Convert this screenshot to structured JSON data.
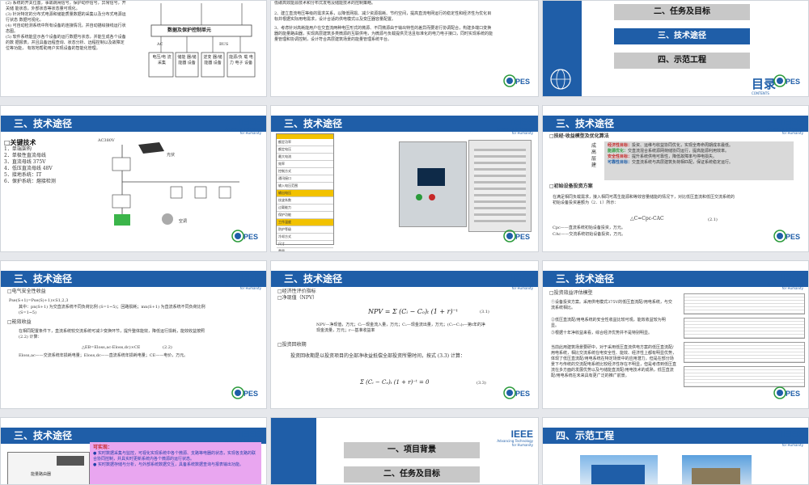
{
  "section_title": "三、技术途径",
  "ieee": {
    "word": "IEEE",
    "sub1": "Advancing Technology",
    "sub2": "for Humanity"
  },
  "pes": {
    "word": "PES",
    "sub": "Power & Energy Society"
  },
  "s1": {
    "items": [
      "(2) 系统的开关位置，事故跳闸信号，保护动作信号，异常信号，开关储 能状态，外部状态等状态量可观化。",
      "(3) 针对特定的分布式电源和储能质量数据的采集以及分布式电源运行状态 数据可视化。",
      "(4) 可自动检测系统中所有设备的连接情况，并自动描绘接线运行状态图。",
      "(5) 软件系统能显示各个设备的运行数据与状态，并能生成各个设备的数 据报表，并且具备远程查询、状态分析、远程控制以及故障定位等功能， 有效地帮助用户实现设备的智能化管理。"
    ],
    "center": "数据及保护控制单元",
    "bottom": [
      "电压/电 流采集",
      "储能 器/储 能器 设备",
      "逆变 器/储 能器 设备",
      "能源/负 载 电力 电子 设备"
    ],
    "top_labels": [
      "AC",
      "BUS"
    ]
  },
  "s2": {
    "lines": [
      "低碳高效能源技术和分布式发电及储能技术的控制策略。",
      "2、建立直流电压等级的需求关系，以降低网损、减少资源损耗、节约空间，提高直流电网运行的稳定性和经济性为优化目标并根据实际用电需求，设计合适的供电模式以及变压器容量配置。",
      "3、考虑针对高耗能用户在交直流两种电压形式的微源、不同微源由于输出特性的差异而要进行协调配合，构建多端口变换器的能量路由器，实现高层建筑多类微源的互联供电，为微源与负载提供灵活且标准化的电力电子接口，同时实现系统的能量管理和协调控制，设计符合高层建筑场景的能量管理系统平台。"
    ]
  },
  "s3": {
    "menu": [
      "二、任务及目标",
      "三、技术途径",
      "四、示范工程"
    ],
    "contents": "目录",
    "contents_en": "CONTENTS"
  },
  "s4": {
    "heading": "□关键技术",
    "items": [
      "1．单端架构",
      "2．单极性直流母线",
      "3．直流母线 375V",
      "4．低压直流母线 48V",
      "5．接地系统：IT",
      "6．保护系统：熔接检测"
    ],
    "labels": [
      "AC380V",
      "光伏",
      "储能",
      "负载",
      "空调"
    ]
  },
  "s5": {
    "rows": [
      "额定功率",
      "额定电压",
      "最大电流",
      "效率",
      "控制方式",
      "通讯接口",
      "输入电压范围",
      "输出电压",
      "纹波系数",
      "过载能力",
      "保护功能",
      "工作温度",
      "防护等级",
      "冷却方式",
      "尺寸",
      "重量"
    ]
  },
  "s6": {
    "heading1": "□技经·收益模型及优化算法",
    "side_chars": [
      "成",
      "高",
      "层",
      "建"
    ],
    "points": [
      {
        "k": "经济性目标：",
        "v": "投资、运维与收益协同优化，实现全寿命周期成本最低。"
      },
      {
        "k": "能源优化：",
        "v": "交直流混合系统源网荷储协同运行，提高能源利用效率。"
      },
      {
        "k": "安全性目标：",
        "v": "提升系统供电可靠性，降低故障率与停电损失。"
      },
      {
        "k": "可靠性目标：",
        "v": "交直流系统与高层建筑负荷相匹配，保证系统稳定运行。"
      }
    ],
    "heading2": "□初始设备投资方案",
    "para": "在满足相同负载需求，接入相同可再生能源和等效容量储能的情况下，对比低压直流和低压交流系统的初始设备投资差额为（2．1）所示：",
    "formula": "△C=Cpc-CAC",
    "eqno": "(2.1)",
    "legend": [
      "Cpc——直流系统初始设备投资，万元。",
      "CAc——交流系统初始设备投资，万元。"
    ]
  },
  "s7": {
    "heading1": "□电气安全性收益",
    "formula": "Pse(S+1)=Pse(S)+1)×S1,2,3",
    "legend": "其中：pn(S+1) 为交直流系统不同负荷比例 (S=1~5)；回路损耗；mn(S+1) 为直流系统不同负荷比例 (S=1~5)",
    "heading2": "□能效收益",
    "para": "在相同配置条件下，直流系统较交流系统可减少变换环节，提升整体能效，降低运行损耗，能效收益按照 (2.2) 计算：",
    "formula2": "△EB=Eloss,ac-Eloss,dc)×CE",
    "eqno": "(2.2)",
    "legend2": "Eloss,ac——交流系统年损耗电量；Eloss,dc——直流系统年损耗电量；CE——电价，万元。"
  },
  "s8": {
    "heading1": "□经济性评价指标",
    "heading2": "□净现值（NPV）",
    "npv": "NPV = Σ (Cᵢ − Cₒ)ₜ (1 + r)⁻ᵗ",
    "eqno1": "(3.1)",
    "legend": "NPV—净现值，万元；Cᵢ—现金流入量，万元；Cₒ—现金流出量，万元；(Cᵢ−Cₒ)ₜ—第t年的净现金流量，万元；r—基准收益率",
    "heading3": "□投资回收期",
    "para": "投资回收期是以投资项目的全部净收益抵偿全部投资所需时间，按式 (3.3) 计算：",
    "npv2": "Σ (Cᵢ − Cₒ)ₜ (1 + r)⁻ᵗ = 0",
    "eqno2": "(3.3)"
  },
  "s9": {
    "heading": "□投资效益评估模型",
    "p1": "①设备投资方案。采用供电模式375V的低压直流配/用电系统，与交流系统相比。",
    "p2": "②低压直流配/用电系统的安全性收益比较可观，能效收益较为明显。",
    "p3": "③根据十年净收益来看，综合经济优势并不是特别明显。",
    "para": "当前此用建筑场景要研中，对于采用低压直流供电方案的低压直流配/用电系统，相比交流系统在电安全性、能效、经济性上都有明显优势，体现了低压直流配/用电系统在特定场景中的应用潜力，但是在部分场景下与传统的交流配电系统比较经济性存在不明显，但是考虑到低压直流在多方面的发展优势以及与储能直流配/用电技术的成熟，低压直流配/用电系统在未来具有更广泛的推广前景。"
  },
  "s10": {
    "title_box": "可实现：",
    "bullets": [
      "● 实时数据采集与监控，可视化实现系统中各个微源、支路等电器的状态，实现各支路的联合协同控制，并具实时更新系统内各个微源的运行状态。",
      "● 实时数据存储与分析，与外部系统数据交互，具备系统数据查询与报表输出功能。"
    ],
    "box_labels": [
      "能量路由器",
      "通讯管理",
      "数据采集"
    ]
  },
  "s11": {
    "menu": [
      "一、项目背景",
      "二、任务及目标"
    ]
  },
  "s12": {
    "title": "四、示范工程"
  }
}
